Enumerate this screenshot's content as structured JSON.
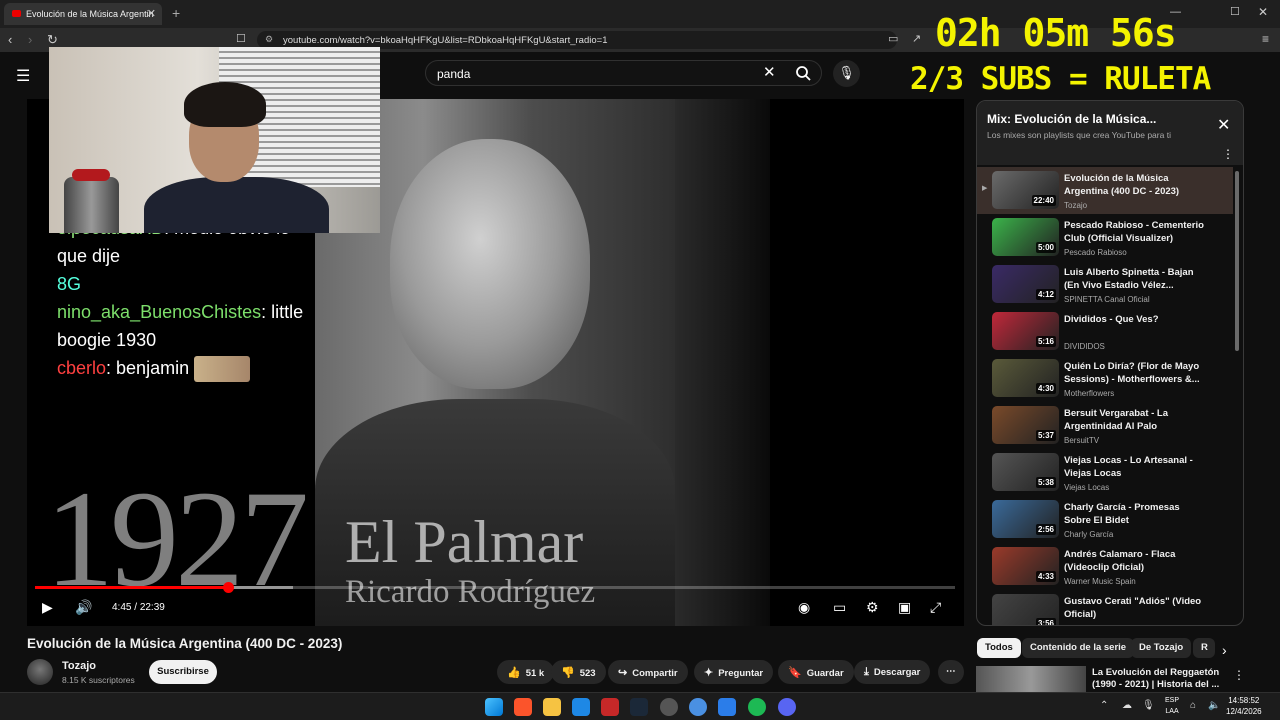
{
  "browser": {
    "tab_title": "Evolución de la Música Argentin",
    "url": "youtube.com/watch?v=bkoaHqHFKgU&list=RDbkoaHqHFKgU&start_radio=1"
  },
  "search": {
    "value": "panda"
  },
  "overlay": {
    "timer": "02h 05m 56s",
    "subs_goal": "2/3 SUBS = RULETA"
  },
  "video": {
    "year": "1927",
    "song": "El Palmar",
    "artist": "Ricardo Rodríguez",
    "time_current": "4:45",
    "time_total": "22:39",
    "progress_fraction": 0.21,
    "buffered_fraction": 0.28
  },
  "chat": [
    {
      "user": "elpecausaXD",
      "text": ": medio obvio lo"
    },
    {
      "user": "",
      "text": "que dije"
    },
    {
      "user": "",
      "text": "8G"
    },
    {
      "user": "nino_aka_BuenosChistes",
      "text": ": little"
    },
    {
      "user": "",
      "text": "boogie 1930"
    },
    {
      "user": "cberlo",
      "text": ": benjamin"
    }
  ],
  "meta": {
    "title": "Evolución de la Música Argentina (400 DC - 2023)",
    "channel": "Tozajo",
    "subscribers": "8.15 K suscriptores",
    "subscribe_label": "Suscribirse",
    "likes": "51 k",
    "dislikes": "523",
    "share": "Compartir",
    "ask": "Preguntar",
    "save": "Guardar",
    "download": "Descargar"
  },
  "playlist": {
    "title": "Mix: Evolución de la Música...",
    "subtitle": "Los mixes son playlists que crea YouTube para ti",
    "items": [
      {
        "title": "Evolución de la Música Argentina (400 DC - 2023)",
        "channel": "Tozajo",
        "duration": "22:40",
        "color": "#6b6b6b"
      },
      {
        "title": "Pescado Rabioso - Cementerio Club (Official Visualizer)",
        "channel": "Pescado Rabioso",
        "duration": "5:00",
        "color": "#3bb34a"
      },
      {
        "title": "Luis Alberto Spinetta - Bajan (En Vivo Estadio Vélez...",
        "channel": "SPINETTA Canal Oficial",
        "duration": "4:12",
        "color": "#3a2a66"
      },
      {
        "title": "Divididos - Que Ves?",
        "channel": "DIVIDIDOS",
        "duration": "5:16",
        "color": "#c0283a"
      },
      {
        "title": "Quién Lo Diría? (Flor de Mayo Sessions) - Motherflowers &...",
        "channel": "Motherflowers",
        "duration": "4:30",
        "color": "#5a5a3a"
      },
      {
        "title": "Bersuit Vergarabat - La Argentinidad Al Palo",
        "channel": "BersuitTV",
        "duration": "5:37",
        "color": "#7a4a2a"
      },
      {
        "title": "Viejas Locas - Lo Artesanal - Viejas Locas",
        "channel": "Viejas Locas",
        "duration": "5:38",
        "color": "#555555"
      },
      {
        "title": "Charly García - Promesas Sobre El Bidet",
        "channel": "Charly García",
        "duration": "2:56",
        "color": "#3a6a9a"
      },
      {
        "title": "Andrés Calamaro - Flaca (Videoclip Oficial)",
        "channel": "Warner Music Spain",
        "duration": "4:33",
        "color": "#9a3a2a"
      },
      {
        "title": "Gustavo Cerati \"Adiós\" (Video Oficial)",
        "channel": "Gustavo Cerati",
        "duration": "3:56",
        "color": "#444444"
      }
    ]
  },
  "chips": [
    "Todos",
    "Contenido de la serie",
    "De Tozajo",
    "R"
  ],
  "recommendation": {
    "title": "La Evolución del Reggaetón (1990 - 2021) | Historia del ..."
  },
  "taskbar": {
    "lang1": "ESP",
    "lang2": "LAA",
    "time": "14:58:52",
    "date": "12/4/2026"
  }
}
